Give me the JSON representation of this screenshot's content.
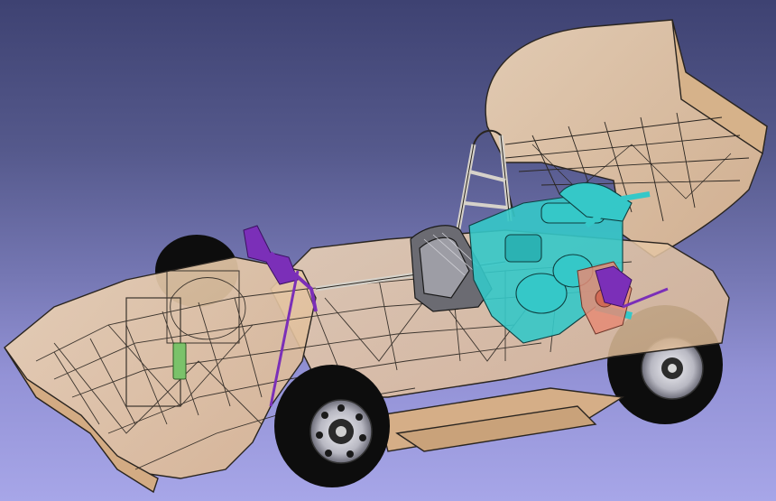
{
  "viewport": {
    "model": "formula-student-car-assembly",
    "render_mode": "transparent-shaded-with-edges",
    "colors": {
      "background_top": "#3e4272",
      "background_bottom": "#a7a6e8",
      "body_fill": "#e9c9a5",
      "body_edge": "#2a2520",
      "frame_tube": "#cfcbc2",
      "engine": "#35c8c8",
      "suspension": "#7b2fb8",
      "tire": "#0d0d0d",
      "rim": "#c9c9cf",
      "exhaust": "#e58b76"
    },
    "components": [
      "rear-wing-icon",
      "roll-hoop-icon",
      "seat-icon",
      "engine-icon",
      "front-wheel-icon",
      "rear-wheel-icon",
      "chassis-frame-icon",
      "suspension-icon",
      "nose-cone-icon",
      "sidepod-icon"
    ]
  }
}
